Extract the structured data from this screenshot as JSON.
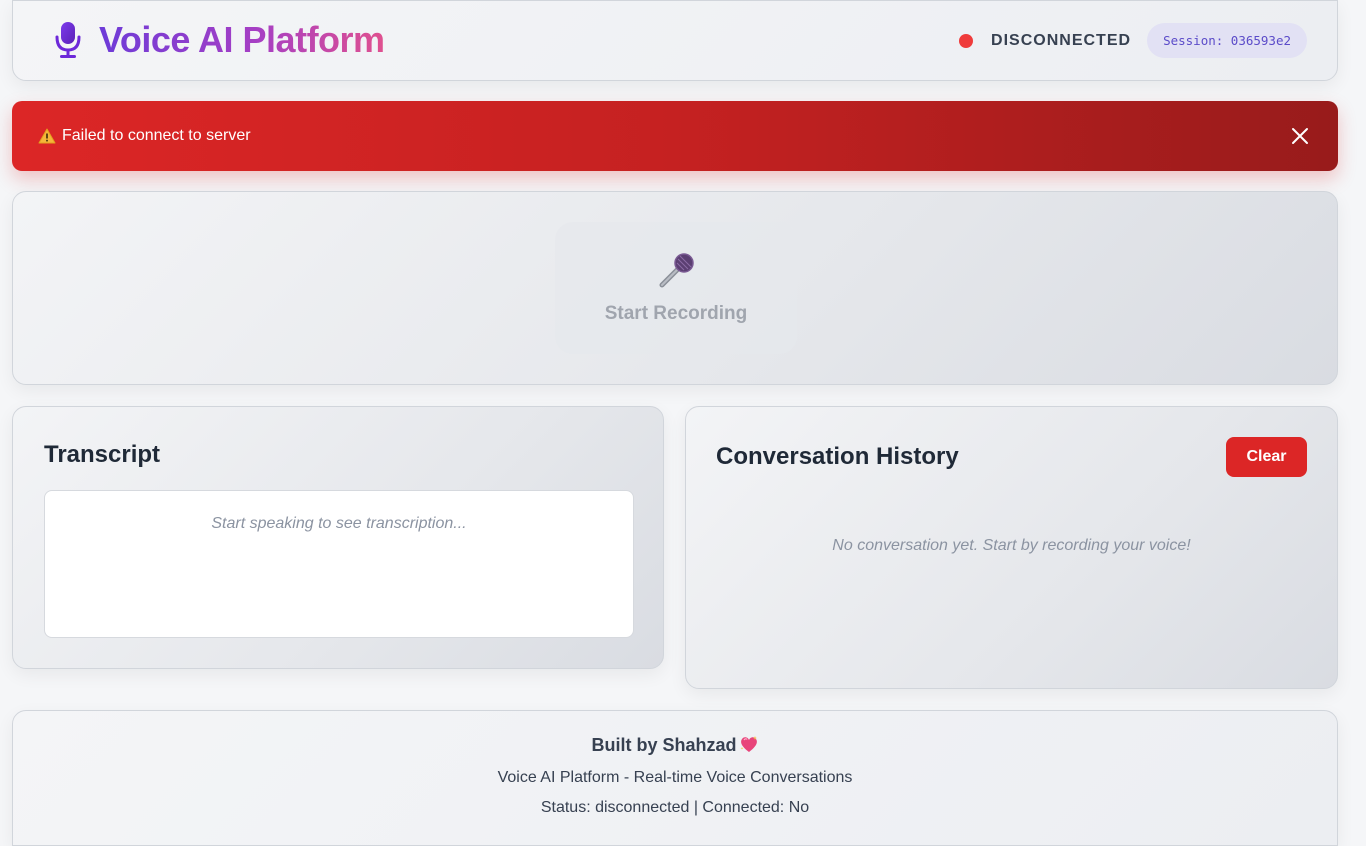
{
  "header": {
    "title": "Voice AI Platform",
    "icon": "microphone-icon",
    "connection_status": "DISCONNECTED",
    "status_color": "#ef3b3b",
    "session": "Session: 036593e2"
  },
  "error": {
    "icon": "warning-icon",
    "message": "Failed to connect to server",
    "close_icon": "close-icon"
  },
  "recorder": {
    "icon": "microphone-emoji-icon",
    "label": "Start Recording"
  },
  "transcript": {
    "title": "Transcript",
    "placeholder": "Start speaking to see transcription..."
  },
  "history": {
    "title": "Conversation History",
    "clear_label": "Clear",
    "empty_message": "No conversation yet. Start by recording your voice!"
  },
  "footer": {
    "built_by": "Built by Shahzad",
    "heart_icon": "sparkling-heart-icon",
    "subtitle": "Voice AI Platform - Real-time Voice Conversations",
    "status_line": "Status: disconnected | Connected: No"
  },
  "colors": {
    "accent_gradient_start": "#6d3bd8",
    "accent_gradient_end": "#e0508f",
    "error_red": "#dc2626",
    "session_text": "#5b4bc9"
  }
}
